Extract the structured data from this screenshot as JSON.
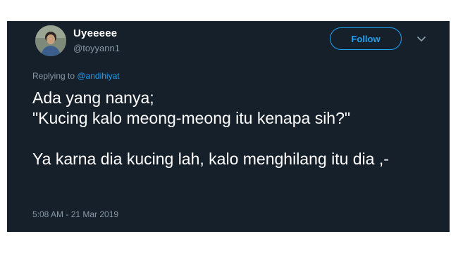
{
  "tweet": {
    "display_name": "Uyeeeee",
    "handle": "@toyyann1",
    "follow_label": "Follow",
    "replying_prefix": "Replying to ",
    "replying_to": "@andihiyat",
    "text": "Ada yang nanya;\n\"Kucing kalo meong-meong itu kenapa sih?\"\n\nYa karna dia kucing lah, kalo menghilang itu dia ,-",
    "timestamp": "5:08 AM - 21 Mar 2019"
  },
  "icons": {
    "avatar": "avatar-photo",
    "menu": "chevron-down-icon"
  },
  "colors": {
    "background": "#15202b",
    "accent": "#1da1f2",
    "text_primary": "#ffffff",
    "text_secondary": "#8899a6"
  }
}
